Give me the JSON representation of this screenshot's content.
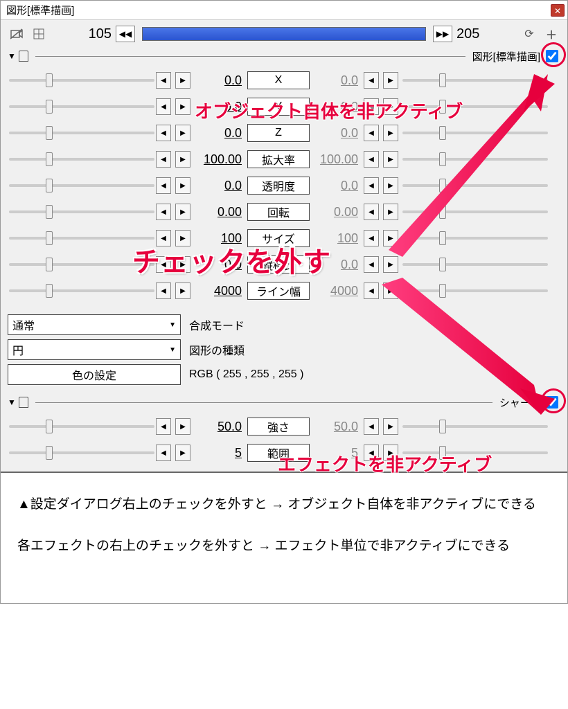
{
  "window": {
    "title": "図形[標準描画]",
    "frame_start": "105",
    "frame_end": "205"
  },
  "section_main": {
    "label": "図形[標準描画]"
  },
  "params": [
    {
      "left": "0.0",
      "name": "X",
      "right": "0.0"
    },
    {
      "left": "0.0",
      "name": "Y",
      "right": "0.0"
    },
    {
      "left": "0.0",
      "name": "Z",
      "right": "0.0"
    },
    {
      "left": "100.00",
      "name": "拡大率",
      "right": "100.00"
    },
    {
      "left": "0.0",
      "name": "透明度",
      "right": "0.0"
    },
    {
      "left": "0.00",
      "name": "回転",
      "right": "0.00"
    },
    {
      "left": "100",
      "name": "サイズ",
      "right": "100"
    },
    {
      "left": "0.0",
      "name": "縦横比",
      "right": "0.0"
    },
    {
      "left": "4000",
      "name": "ライン幅",
      "right": "4000"
    }
  ],
  "blend": {
    "value": "通常",
    "label": "合成モード"
  },
  "shape": {
    "value": "円",
    "label": "図形の種類"
  },
  "color": {
    "button": "色の設定",
    "value": "RGB ( 255 , 255 , 255 )"
  },
  "section_effect": {
    "label": "シャープ"
  },
  "effect_params": [
    {
      "left": "50.0",
      "name": "強さ",
      "right": "50.0"
    },
    {
      "left": "5",
      "name": "範囲",
      "right": "5"
    }
  ],
  "annotations": {
    "top": "オブジェクト自体を非アクティブ",
    "big": "チェックを外す",
    "bottom": "エフェクトを非アクティブ"
  },
  "caption": {
    "p1": "▲設定ダイアログ右上のチェックを外すと → オブジェクト自体を非アクティブにできる",
    "p2": "各エフェクトの右上のチェックを外すと → エフェクト単位で非アクティブにできる"
  }
}
